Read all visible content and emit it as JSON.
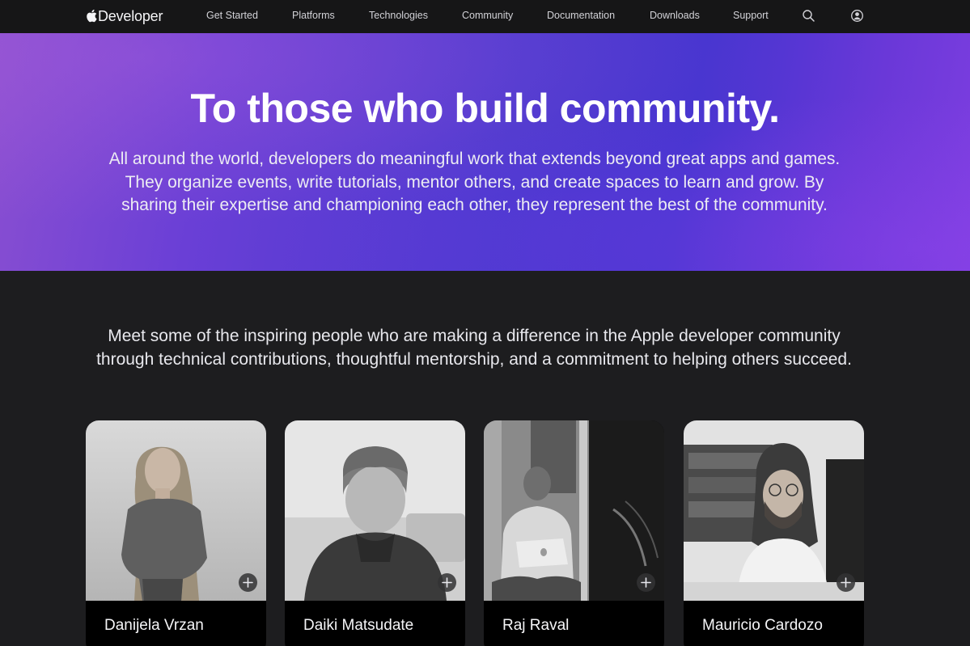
{
  "nav": {
    "logo_text": "Developer",
    "items": [
      "Get Started",
      "Platforms",
      "Technologies",
      "Community",
      "Documentation",
      "Downloads",
      "Support"
    ],
    "search_icon": "search-icon",
    "account_icon": "account-icon"
  },
  "hero": {
    "title": "To those who build community.",
    "body": "All around the world, developers do meaningful work that extends beyond great apps and games. They organize events, write tutorials, mentor others, and create spaces to learn and grow. By sharing their expertise and championing each other, they represent the best of the community."
  },
  "intro": {
    "text": "Meet some of the inspiring people who are making a difference in the Apple developer community through technical contributions, thoughtful mentorship, and a commitment to helping others succeed."
  },
  "cards": [
    {
      "name": "Danijela Vrzan"
    },
    {
      "name": "Daiki Matsudate"
    },
    {
      "name": "Raj Raval"
    },
    {
      "name": "Mauricio Cardozo"
    }
  ],
  "colors": {
    "nav_bg": "#161617",
    "page_bg": "#1d1d1f",
    "hero_start": "#8a4fd1",
    "hero_mid": "#4a38cf",
    "hero_end": "#7d3ee0"
  }
}
